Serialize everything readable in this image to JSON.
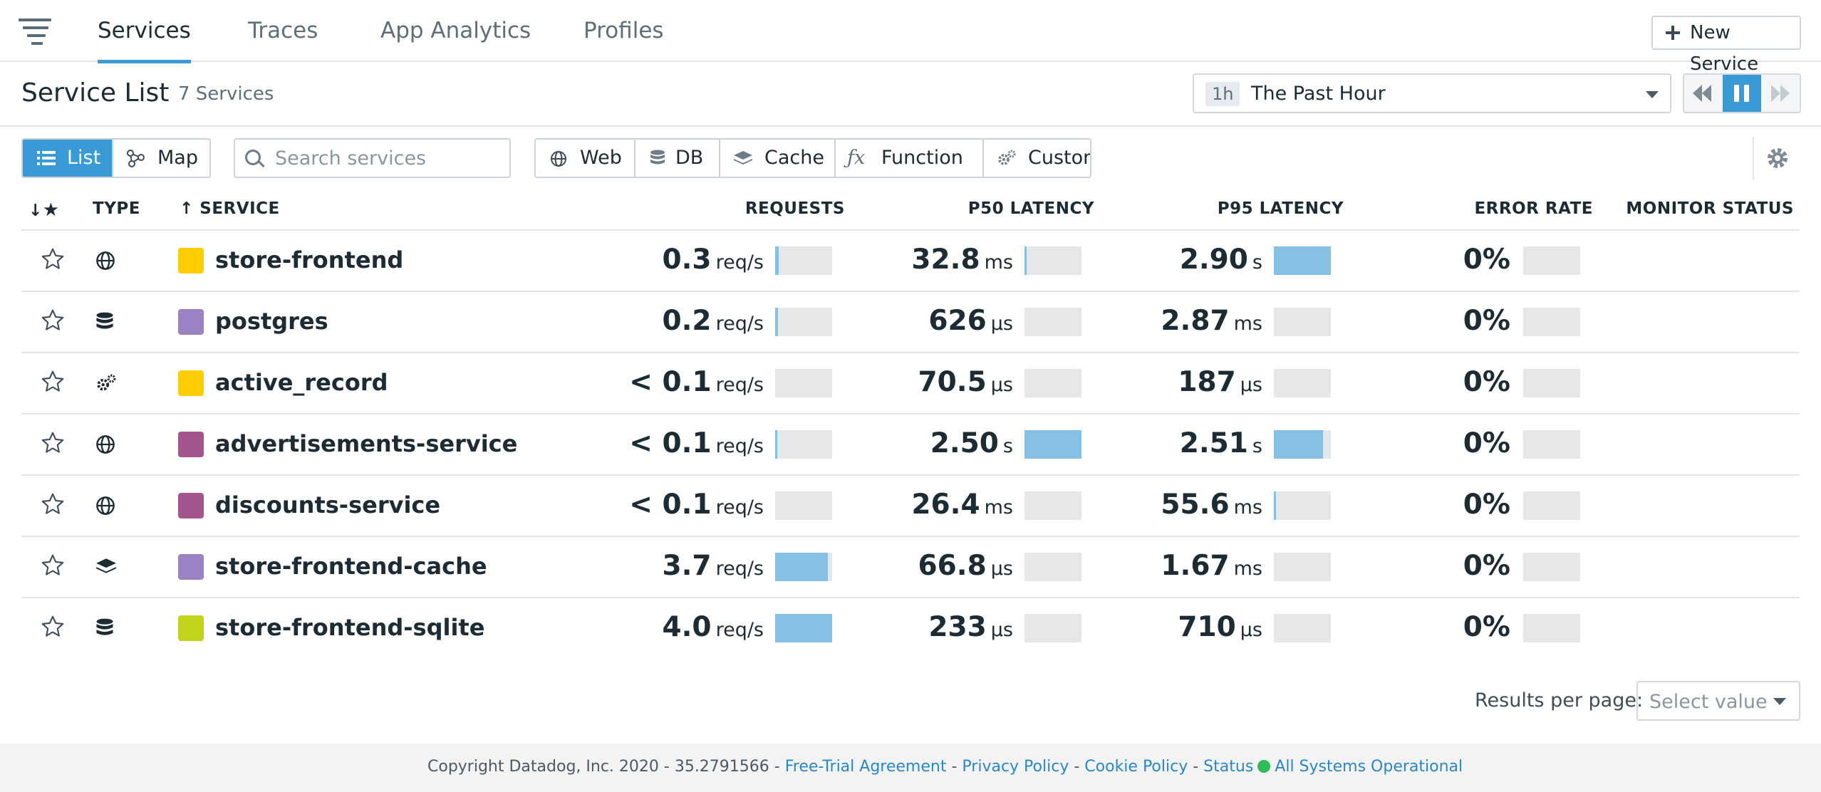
{
  "nav": {
    "tabs": [
      {
        "label": "Services",
        "active": true
      },
      {
        "label": "Traces",
        "active": false
      },
      {
        "label": "App Analytics",
        "active": false
      },
      {
        "label": "Profiles",
        "active": false
      }
    ],
    "new_service_label": "New Service"
  },
  "header": {
    "title": "Service List",
    "count": "7 Services",
    "time_badge": "1h",
    "time_label": "The Past Hour"
  },
  "toolbar": {
    "view_list_label": "List",
    "view_map_label": "Map",
    "search_placeholder": "Search services",
    "filters": [
      "Web",
      "DB",
      "Cache",
      "Function",
      "Custom"
    ]
  },
  "table": {
    "columns": {
      "type": "TYPE",
      "service": "SERVICE",
      "requests": "REQUESTS",
      "p50": "P50 LATENCY",
      "p95": "P95 LATENCY",
      "error_rate": "ERROR RATE",
      "monitor_status": "MONITOR STATUS"
    },
    "rows": [
      {
        "name": "store-frontend",
        "type": "web",
        "color": "#ffcd00",
        "requests": "0.3",
        "requests_unit": "req/s",
        "requests_level": 0.06,
        "p50": "32.8",
        "p50_unit": "ms",
        "p50_level": 0.02,
        "p95": "2.90",
        "p95_unit": "s",
        "p95_level": 1.0,
        "error_rate": "0%",
        "error_level": 0
      },
      {
        "name": "postgres",
        "type": "db",
        "color": "#9a82c4",
        "requests": "0.2",
        "requests_unit": "req/s",
        "requests_level": 0.05,
        "p50": "626",
        "p50_unit": "µs",
        "p50_level": 0,
        "p95": "2.87",
        "p95_unit": "ms",
        "p95_level": 0,
        "error_rate": "0%",
        "error_level": 0
      },
      {
        "name": "active_record",
        "type": "custom",
        "color": "#ffcd00",
        "requests": "< 0.1",
        "requests_unit": "req/s",
        "requests_level": 0,
        "p50": "70.5",
        "p50_unit": "µs",
        "p50_level": 0,
        "p95": "187",
        "p95_unit": "µs",
        "p95_level": 0,
        "error_rate": "0%",
        "error_level": 0
      },
      {
        "name": "advertisements-service",
        "type": "web",
        "color": "#a3568d",
        "requests": "< 0.1",
        "requests_unit": "req/s",
        "requests_level": 0.02,
        "p50": "2.50",
        "p50_unit": "s",
        "p50_level": 1.0,
        "p95": "2.51",
        "p95_unit": "s",
        "p95_level": 0.86,
        "error_rate": "0%",
        "error_level": 0
      },
      {
        "name": "discounts-service",
        "type": "web",
        "color": "#a3568d",
        "requests": "< 0.1",
        "requests_unit": "req/s",
        "requests_level": 0,
        "p50": "26.4",
        "p50_unit": "ms",
        "p50_level": 0,
        "p95": "55.6",
        "p95_unit": "ms",
        "p95_level": 0.02,
        "error_rate": "0%",
        "error_level": 0
      },
      {
        "name": "store-frontend-cache",
        "type": "cache",
        "color": "#9a82c4",
        "requests": "3.7",
        "requests_unit": "req/s",
        "requests_level": 0.93,
        "p50": "66.8",
        "p50_unit": "µs",
        "p50_level": 0,
        "p95": "1.67",
        "p95_unit": "ms",
        "p95_level": 0,
        "error_rate": "0%",
        "error_level": 0
      },
      {
        "name": "store-frontend-sqlite",
        "type": "db",
        "color": "#c3d21b",
        "requests": "4.0",
        "requests_unit": "req/s",
        "requests_level": 1.0,
        "p50": "233",
        "p50_unit": "µs",
        "p50_level": 0,
        "p95": "710",
        "p95_unit": "µs",
        "p95_level": 0,
        "error_rate": "0%",
        "error_level": 0
      }
    ]
  },
  "pagination": {
    "label": "Results per page:",
    "placeholder": "Select value"
  },
  "footer": {
    "copyright": "Copyright Datadog, Inc. 2020 - 35.2791566 - ",
    "links": [
      "Free-Trial Agreement",
      "Privacy Policy",
      "Cookie Policy",
      "Status"
    ],
    "status_text": "All Systems Operational"
  },
  "colors": {
    "accent": "#3a9ad6",
    "bar_fill": "#86c1e4",
    "bar_track": "#e6e7e9",
    "status_ok": "#2fba5c"
  }
}
